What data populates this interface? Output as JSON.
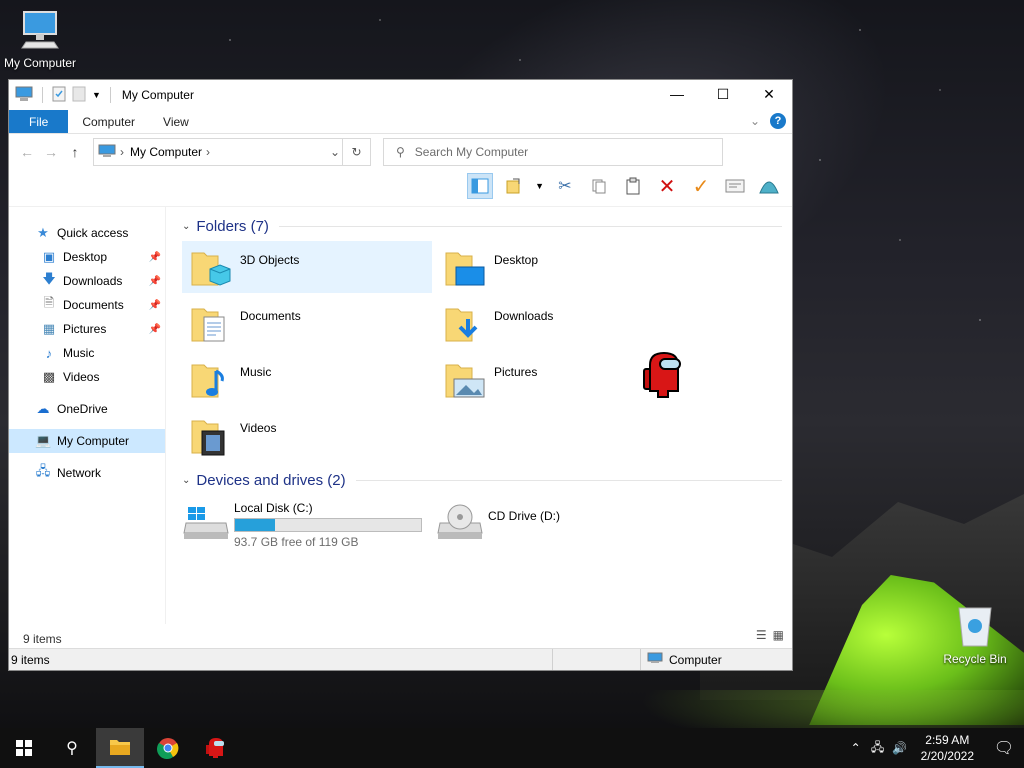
{
  "desktop": {
    "icons": [
      {
        "label": "My Computer"
      },
      {
        "label": "Recycle Bin"
      }
    ]
  },
  "window": {
    "title": "My Computer",
    "ribbon_tabs": [
      "File",
      "Computer",
      "View"
    ],
    "address": "My Computer",
    "search_placeholder": "Search My Computer",
    "nav": {
      "quick_access": "Quick access",
      "items": [
        "Desktop",
        "Downloads",
        "Documents",
        "Pictures",
        "Music",
        "Videos"
      ],
      "onedrive": "OneDrive",
      "my_computer": "My Computer",
      "network": "Network"
    },
    "folders_header": "Folders (7)",
    "folders": [
      "3D Objects",
      "Desktop",
      "Documents",
      "Downloads",
      "Music",
      "Pictures",
      "Videos"
    ],
    "drives_header": "Devices and drives (2)",
    "drives": [
      {
        "name": "Local Disk (C:)",
        "free": "93.7 GB free of 119 GB",
        "used_fraction": 0.213
      },
      {
        "name": "CD Drive (D:)"
      }
    ],
    "status_count_inner": "9 items",
    "status_count": "9 items",
    "status_location": "Computer"
  },
  "taskbar": {
    "time": "2:59 AM",
    "date": "2/20/2022"
  },
  "colors": {
    "accent": "#1979ca",
    "folder_yellow": "#f8d775",
    "selection": "#cce8ff"
  }
}
